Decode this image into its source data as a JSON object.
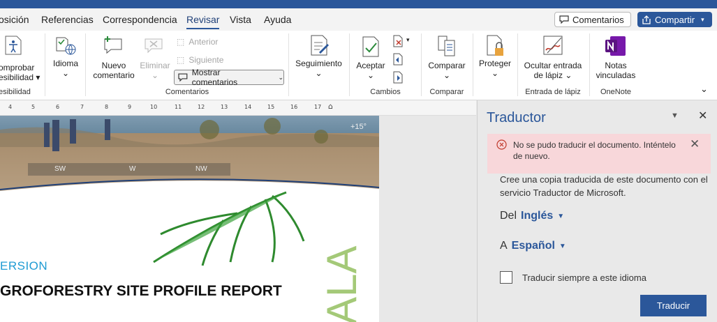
{
  "tabs": [
    "osición",
    "Referencias",
    "Correspondencia",
    "Revisar",
    "Vista",
    "Ayuda"
  ],
  "header": {
    "comments_label": "Comentarios",
    "share_label": "Compartir"
  },
  "ribbon": {
    "check_access_line1": "omprobar",
    "check_access_line2": "esibilidad",
    "group_access": "esibilidad",
    "language": "Idioma",
    "new_comment_line1": "Nuevo",
    "new_comment_line2": "comentario",
    "delete": "Eliminar",
    "previous": "Anterior",
    "next": "Siguiente",
    "show_comments": "Mostrar comentarios",
    "group_comments": "Comentarios",
    "tracking": "Seguimiento",
    "accept": "Aceptar",
    "group_changes": "Cambios",
    "compare": "Comparar",
    "group_compare": "Comparar",
    "protect": "Proteger",
    "hide_ink_line1": "Ocultar entrada",
    "hide_ink_line2": "de lápiz",
    "group_ink": "Entrada de lápiz",
    "notes_line1": "Notas",
    "notes_line2": "vinculadas",
    "group_onenote": "OneNote"
  },
  "ruler_ticks": [
    "4",
    "5",
    "6",
    "7",
    "8",
    "9",
    "10",
    "11",
    "12",
    "13",
    "14",
    "15",
    "16",
    "17"
  ],
  "document": {
    "compass": [
      "SW",
      "W",
      "NW"
    ],
    "degree": "+15°",
    "version_text": "ERSION",
    "report_title": "GROFORESTRY SITE PROFILE REPORT",
    "vertical_text": "ALA"
  },
  "pane": {
    "title": "Traductor",
    "error": "No se pudo traducir el documento. Inténtelo de nuevo.",
    "description": "Cree una copia traducida de este documento con el servicio Traductor de Microsoft.",
    "from_prefix": "Del",
    "from_lang": "Inglés",
    "to_prefix": "A",
    "to_lang": "Español",
    "always_translate": "Traducir siempre a este idioma",
    "translate_button": "Traducir"
  },
  "colors": {
    "accent": "#2b579a",
    "error_bg": "#f8d7da",
    "version": "#1e9bd3"
  }
}
